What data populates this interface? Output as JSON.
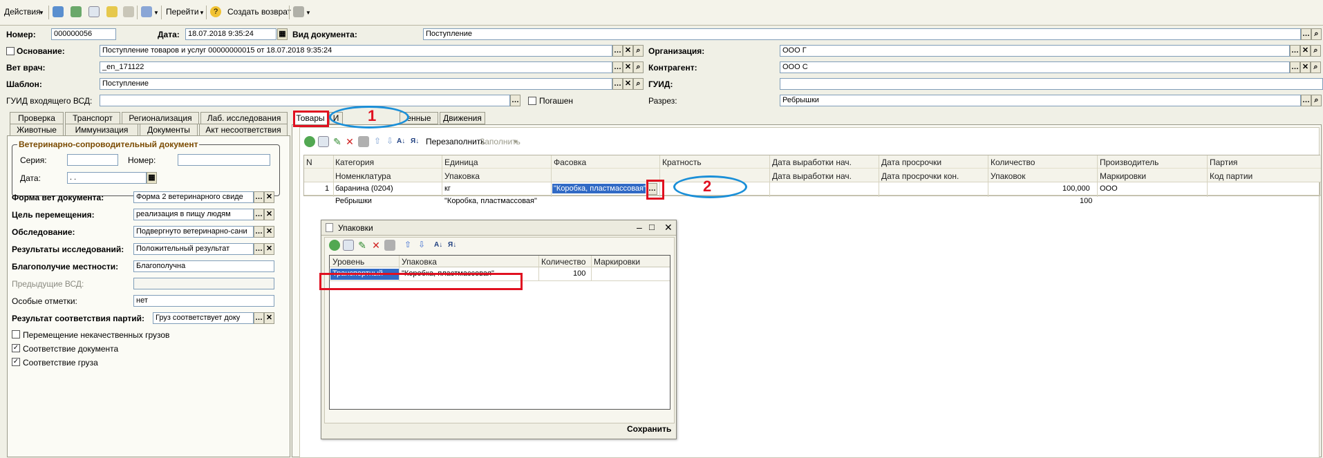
{
  "toolbar": {
    "actions": "Действия",
    "goto": "Перейти",
    "create_return": "Создать возврат"
  },
  "header": {
    "number_label": "Номер:",
    "number": "000000056",
    "date_label": "Дата:",
    "date": "18.07.2018 9:35:24",
    "doctype_label": "Вид документа:",
    "doctype": "Поступление",
    "basis_label": "Основание:",
    "basis": "Поступление товаров и услуг 00000000015 от 18.07.2018 9:35:24",
    "org_label": "Организация:",
    "org": "ООО  Г",
    "vet_label": "Вет врач:",
    "vet": "           _en_171122",
    "counterparty_label": "Контрагент:",
    "counterparty": "ООО  С",
    "template_label": "Шаблон:",
    "template": "Поступление",
    "guid_label": "ГУИД:",
    "guid": "",
    "guid_vsd_label": "ГУИД входящего ВСД:",
    "guid_vsd": "",
    "repaid_label": "Погашен",
    "cut_label": "Разрез:",
    "cut": "Ребрышки"
  },
  "left_tabs": {
    "row1": [
      "Проверка",
      "Транспорт",
      "Регионализация",
      "Лаб. исследования"
    ],
    "row2": [
      "Животные",
      "Иммунизация",
      "Документы",
      "Акт несоответствия"
    ]
  },
  "vsd": {
    "group_title": "Ветеринарно-сопроводительный документ",
    "series_label": "Серия:",
    "series": "",
    "num_label": "Номер:",
    "num": "",
    "date_label": "Дата:",
    "date": " .  ."
  },
  "left_form": {
    "form_label": "Форма вет документа:",
    "form": "Форма 2 ветеринарного свиде",
    "purpose_label": "Цель перемещения:",
    "purpose": "реализация в пищу людям",
    "exam_label": "Обследование:",
    "exam": "Подвергнуто ветеринарно-сани",
    "results_label": "Результаты исследований:",
    "results": "Положительный результат",
    "welfare_label": "Благополучие местности:",
    "welfare": "Благополучна",
    "prev_label": "Предыдущие ВСД:",
    "prev": "",
    "notes_label": "Особые отметки:",
    "notes": "нет",
    "match_label": "Результат соответствия партий:",
    "match": "Груз соответствует доку",
    "chk1": "Перемещение некачественных грузов",
    "chk2": "Соответствие документа",
    "chk3": "Соответствие груза"
  },
  "right_tabs": [
    "Товары",
    "И",
    "енные",
    "Движения"
  ],
  "goods_toolbar": {
    "refill": "Перезаполнить",
    "fill": "Заполнить"
  },
  "grid": {
    "headers1": [
      "N",
      "Категория",
      "Единица",
      "Фасовка",
      "Кратность",
      "Дата выработки нач.",
      "Дата просрочки",
      "Количество",
      "Производитель",
      "Партия"
    ],
    "headers2": [
      "Номенклатура",
      "Упаковка",
      "",
      "",
      "Дата выработки нач.",
      "Дата просрочки кон.",
      "Упаковок",
      "Маркировки",
      "Код партии"
    ],
    "row1": {
      "n": "1",
      "category": "баранина (0204)",
      "unit": "кг",
      "packing": "\"Коробка, пластмассовая\"",
      "qty": "100,000",
      "producer": "ООО"
    },
    "row2": {
      "nomenclature": "Ребрышки",
      "package": "\"Коробка, пластмассовая\"",
      "packs": "100"
    }
  },
  "dialog": {
    "title": "Упаковки",
    "headers": [
      "Уровень",
      "Упаковка",
      "Количество",
      "Маркировки"
    ],
    "row": {
      "level": "Транспортный",
      "package": "\"Коробка, пластмассовая\"",
      "qty": "100",
      "marks": ""
    },
    "save": "Сохранить"
  },
  "annotations": {
    "a1": "1",
    "a2": "2"
  }
}
